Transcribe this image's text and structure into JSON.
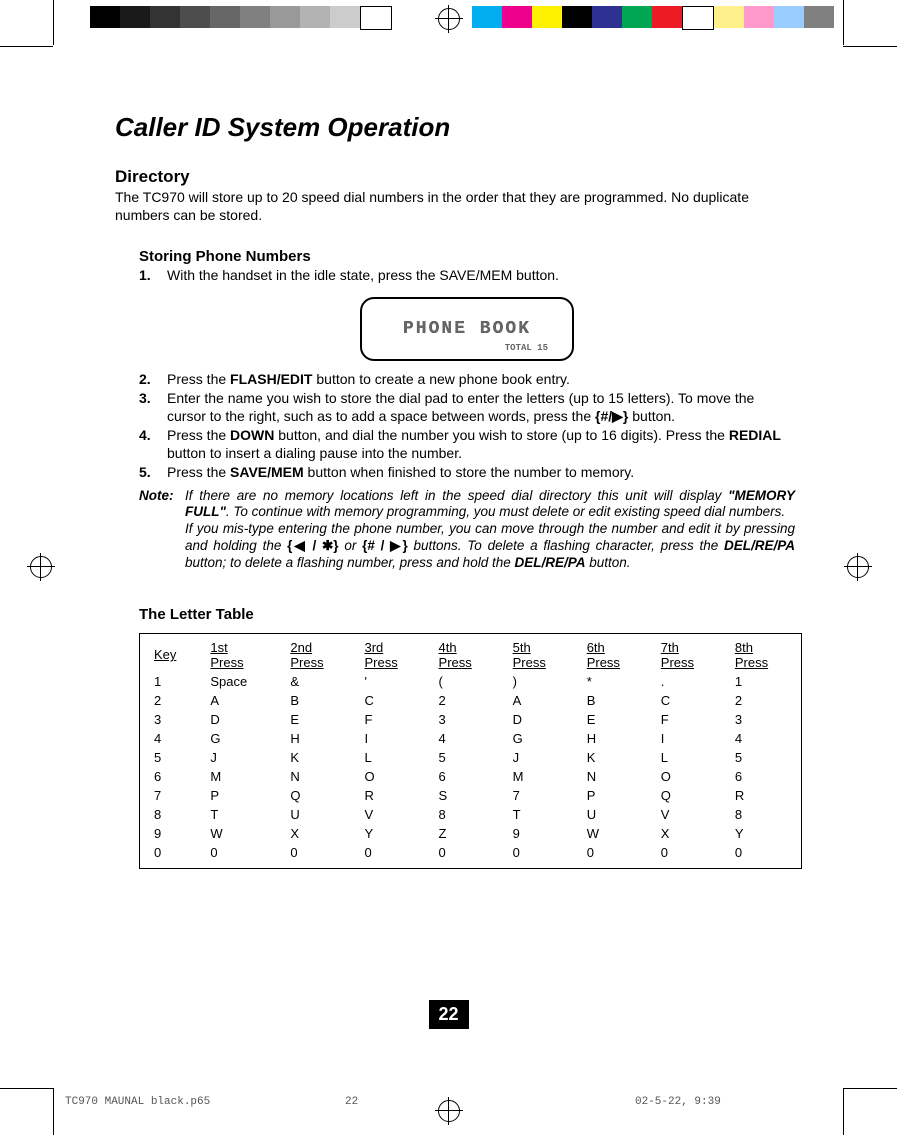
{
  "page": {
    "title": "Caller ID System Operation",
    "directory": {
      "heading": "Directory",
      "desc": "The TC970 will store up to 20 speed dial numbers in the order that they are programmed. No duplicate numbers can be stored."
    },
    "storing": {
      "heading": "Storing Phone Numbers",
      "steps": [
        {
          "num": "1.",
          "text": "With the handset in the idle state, press the SAVE/MEM button."
        },
        {
          "num": "2.",
          "prefix": "Press the ",
          "bold": "FLASH/EDIT",
          "suffix": " button to create a new phone book entry."
        },
        {
          "num": "3.",
          "text": "Enter the name you wish to store the dial pad to enter the letters (up to 15 letters). To move the cursor to the right, such as to add a space between words, press the ",
          "bold_tail": "{#/▶}",
          "tail": " button."
        },
        {
          "num": "4.",
          "prefix": "Press the ",
          "bold": "DOWN",
          "mid": " button, and dial the number you wish to store (up to 16 digits). Press the ",
          "bold2": "REDIAL",
          "suffix": " button to insert a dialing pause into the number."
        },
        {
          "num": "5.",
          "prefix": "Press the ",
          "bold": "SAVE/MEM",
          "suffix": " button when finished to store the number to memory."
        }
      ],
      "lcd": {
        "line1": "PHONE BOOK",
        "line2": "TOTAL 15"
      },
      "note": {
        "label": "Note:",
        "p1a": "If there are no memory locations left in the speed dial directory this unit will display ",
        "p1b": "\"MEMORY FULL\"",
        "p1c": ". To continue with memory programming, you must delete or edit existing speed dial numbers.",
        "p2a": "If you mis-type entering the phone number, you can move through the number and edit it by pressing and holding the ",
        "sym1": "{◀ / ✱}",
        "p2b": " or ",
        "sym2": "{# / ▶}",
        "p2c": " buttons. To delete a flashing character, press the ",
        "b1": "DEL/RE/PA",
        "p2d": " button; to delete a flashing number, press and hold the ",
        "b2": "DEL/RE/PA",
        "p2e": " button."
      }
    },
    "letter_table": {
      "heading": "The Letter Table",
      "header": [
        "Key",
        "1st Press",
        "2nd Press",
        "3rd Press",
        "4th Press",
        "5th Press",
        "6th Press",
        "7th Press",
        "8th Press"
      ],
      "rows": [
        [
          "1",
          "Space",
          "&",
          "'",
          "(",
          ")",
          "*",
          ".",
          "1"
        ],
        [
          "2",
          "A",
          "B",
          "C",
          "2",
          "A",
          "B",
          "C",
          "2"
        ],
        [
          "3",
          "D",
          "E",
          "F",
          "3",
          "D",
          "E",
          "F",
          "3"
        ],
        [
          "4",
          "G",
          "H",
          "I",
          "4",
          "G",
          "H",
          "I",
          "4"
        ],
        [
          "5",
          "J",
          "K",
          "L",
          "5",
          "J",
          "K",
          "L",
          "5"
        ],
        [
          "6",
          "M",
          "N",
          "O",
          "6",
          "M",
          "N",
          "O",
          "6"
        ],
        [
          "7",
          "P",
          "Q",
          "R",
          "S",
          "7",
          "P",
          "Q",
          "R"
        ],
        [
          "8",
          "T",
          "U",
          "V",
          "8",
          "T",
          "U",
          "V",
          "8"
        ],
        [
          "9",
          "W",
          "X",
          "Y",
          "Z",
          "9",
          "W",
          "X",
          "Y"
        ],
        [
          "0",
          "0",
          "0",
          "0",
          "0",
          "0",
          "0",
          "0",
          "0"
        ]
      ]
    },
    "page_number": "22",
    "footer": {
      "filename": "TC970 MAUNAL black.p65",
      "page": "22",
      "date": "02-5-22, 9:39"
    }
  },
  "gray_swatches": [
    "#000",
    "#1a1a1a",
    "#333",
    "#4d4d4d",
    "#666",
    "#808080",
    "#999",
    "#b3b3b3",
    "#ccc",
    "#fff"
  ],
  "color_swatches": [
    "#00aeef",
    "#ec008c",
    "#fff200",
    "#000",
    "#2e3192",
    "#00a651",
    "#ed1c24",
    "#fff",
    "#fef08a",
    "#f9c",
    "#9cf",
    "#808080"
  ]
}
